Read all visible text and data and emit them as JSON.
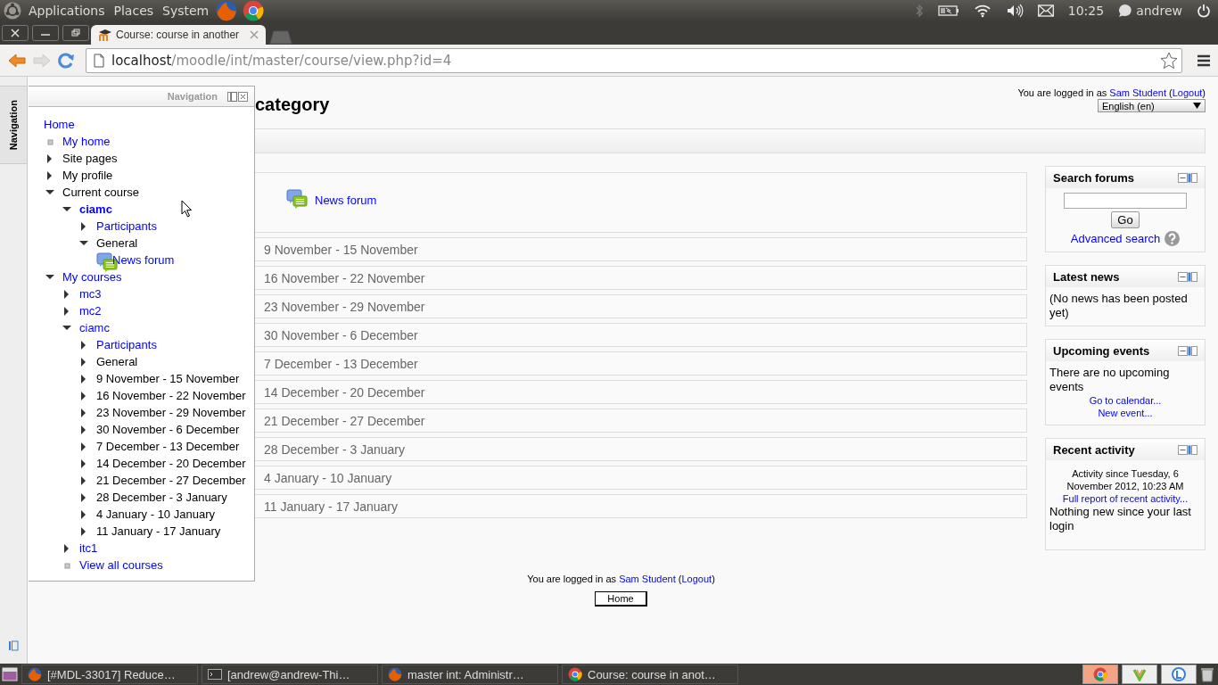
{
  "top_panel": {
    "menus": [
      "Applications",
      "Places",
      "System"
    ],
    "clock": "10:25",
    "user": "andrew"
  },
  "browser": {
    "tabs": [
      {
        "title": "Course: course in another",
        "selected": true
      }
    ],
    "url_host": "localhost",
    "url_path": "/moodle/int/master/course/view.php?id=4"
  },
  "header": {
    "login": [
      {
        "text": "You are logged in as "
      },
      {
        "link": "Sam Student"
      },
      {
        "text": " ("
      },
      {
        "link": "Logout"
      },
      {
        "text": ")"
      }
    ],
    "language": "English (en)",
    "heading": "category"
  },
  "sections": [
    {
      "kind": "activities",
      "activities": [
        {
          "title": "News forum"
        }
      ]
    },
    {
      "kind": "week",
      "title": "9 November - 15 November"
    },
    {
      "kind": "week",
      "title": "16 November - 22 November"
    },
    {
      "kind": "week",
      "title": "23 November - 29 November"
    },
    {
      "kind": "week",
      "title": "30 November - 6 December"
    },
    {
      "kind": "week",
      "title": "7 December - 13 December"
    },
    {
      "kind": "week",
      "title": "14 December - 20 December"
    },
    {
      "kind": "week",
      "title": "21 December - 27 December"
    },
    {
      "kind": "week",
      "title": "28 December - 3 January"
    },
    {
      "kind": "week",
      "title": "4 January - 10 January"
    },
    {
      "kind": "week",
      "title": "11 January - 17 January"
    }
  ],
  "blocks": [
    {
      "kind": "search",
      "title": "Search forums",
      "button": "Go",
      "link": "Advanced search"
    },
    {
      "kind": "text",
      "title": "Latest news",
      "text": "(No news has been posted yet)"
    },
    {
      "kind": "events",
      "title": "Upcoming events",
      "text": "There are no upcoming events",
      "links": [
        "Go to calendar...",
        "New event..."
      ]
    },
    {
      "kind": "activity",
      "title": "Recent activity",
      "since": "Activity since Tuesday, 6 November 2012, 10:23 AM",
      "link": "Full report of recent activity...",
      "text": "Nothing new since your last login"
    }
  ],
  "navigation": {
    "dock_tab": "Navigation",
    "title": "Navigation",
    "tree": [
      {
        "label": "Home",
        "link": true,
        "current": false,
        "children": [
          {
            "label": "My home",
            "link": true,
            "kind": "leaf",
            "current": false
          },
          {
            "label": "Site pages",
            "link": false,
            "kind": "branch",
            "expanded": false,
            "current": false
          },
          {
            "label": "My profile",
            "link": false,
            "kind": "branch",
            "expanded": false,
            "current": false
          },
          {
            "label": "Current course",
            "link": false,
            "kind": "branch",
            "expanded": true,
            "current": false,
            "children": [
              {
                "label": "ciamc",
                "link": true,
                "kind": "branch",
                "expanded": true,
                "current": true,
                "children": [
                  {
                    "label": "Participants",
                    "link": true,
                    "kind": "branch",
                    "expanded": false,
                    "current": false
                  },
                  {
                    "label": "General",
                    "link": false,
                    "kind": "branch",
                    "expanded": true,
                    "current": false,
                    "children": [
                      {
                        "label": "News forum",
                        "link": true,
                        "kind": "activity",
                        "current": false
                      }
                    ]
                  }
                ]
              }
            ]
          },
          {
            "label": "My courses",
            "link": true,
            "kind": "branch",
            "expanded": true,
            "current": false,
            "children": [
              {
                "label": "mc3",
                "link": true,
                "kind": "branch",
                "expanded": false,
                "current": false
              },
              {
                "label": "mc2",
                "link": true,
                "kind": "branch",
                "expanded": false,
                "current": false
              },
              {
                "label": "ciamc",
                "link": true,
                "kind": "branch",
                "expanded": true,
                "current": false,
                "children": [
                  {
                    "label": "Participants",
                    "link": true,
                    "kind": "branch",
                    "expanded": false,
                    "current": false
                  },
                  {
                    "label": "General",
                    "link": false,
                    "kind": "branch",
                    "expanded": false,
                    "current": false
                  },
                  {
                    "label": "9 November - 15 November",
                    "link": false,
                    "kind": "branch",
                    "expanded": false,
                    "current": false
                  },
                  {
                    "label": "16 November - 22 November",
                    "link": false,
                    "kind": "branch",
                    "expanded": false,
                    "current": false
                  },
                  {
                    "label": "23 November - 29 November",
                    "link": false,
                    "kind": "branch",
                    "expanded": false,
                    "current": false
                  },
                  {
                    "label": "30 November - 6 December",
                    "link": false,
                    "kind": "branch",
                    "expanded": false,
                    "current": false
                  },
                  {
                    "label": "7 December - 13 December",
                    "link": false,
                    "kind": "branch",
                    "expanded": false,
                    "current": false
                  },
                  {
                    "label": "14 December - 20 December",
                    "link": false,
                    "kind": "branch",
                    "expanded": false,
                    "current": false
                  },
                  {
                    "label": "21 December - 27 December",
                    "link": false,
                    "kind": "branch",
                    "expanded": false,
                    "current": false
                  },
                  {
                    "label": "28 December - 3 January",
                    "link": false,
                    "kind": "branch",
                    "expanded": false,
                    "current": false
                  },
                  {
                    "label": "4 January - 10 January",
                    "link": false,
                    "kind": "branch",
                    "expanded": false,
                    "current": false
                  },
                  {
                    "label": "11 January - 17 January",
                    "link": false,
                    "kind": "branch",
                    "expanded": false,
                    "current": false
                  }
                ]
              },
              {
                "label": "itc1",
                "link": true,
                "kind": "branch",
                "expanded": false,
                "current": false
              },
              {
                "label": "View all courses",
                "link": true,
                "kind": "leaf",
                "current": false
              }
            ]
          }
        ]
      }
    ]
  },
  "footer": {
    "login": [
      {
        "text": "You are logged in as "
      },
      {
        "link": "Sam Student"
      },
      {
        "text": " ("
      },
      {
        "link": "Logout"
      },
      {
        "text": ")"
      }
    ],
    "home_button": "Home"
  },
  "taskbar": {
    "items": [
      {
        "kind": "firefox",
        "title": "[#MDL-33017] Reduce…"
      },
      {
        "kind": "terminal",
        "title": "[andrew@andrew-Thi…"
      },
      {
        "kind": "firefox",
        "title": "master int: Administr…"
      },
      {
        "kind": "chrome",
        "title": "Course: course in anot…"
      }
    ]
  }
}
